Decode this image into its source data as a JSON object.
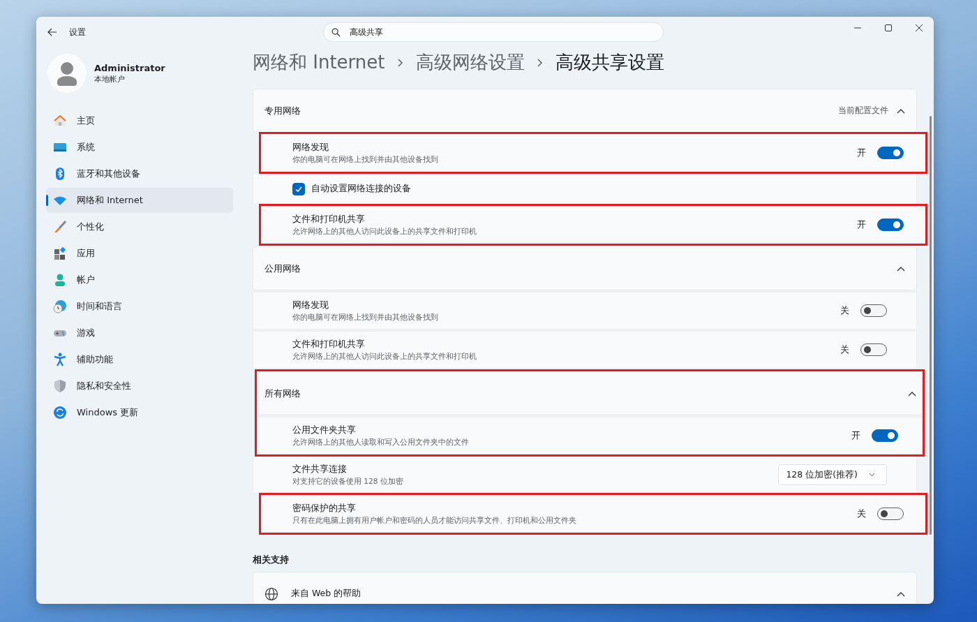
{
  "window": {
    "title": "设置"
  },
  "search": {
    "value": "高级共享"
  },
  "account": {
    "name": "Administrator",
    "type": "本地帐户"
  },
  "nav": [
    {
      "label": "主页",
      "selected": false
    },
    {
      "label": "系统",
      "selected": false
    },
    {
      "label": "蓝牙和其他设备",
      "selected": false
    },
    {
      "label": "网络和 Internet",
      "selected": true
    },
    {
      "label": "个性化",
      "selected": false
    },
    {
      "label": "应用",
      "selected": false
    },
    {
      "label": "帐户",
      "selected": false
    },
    {
      "label": "时间和语言",
      "selected": false
    },
    {
      "label": "游戏",
      "selected": false
    },
    {
      "label": "辅助功能",
      "selected": false
    },
    {
      "label": "隐私和安全性",
      "selected": false
    },
    {
      "label": "Windows 更新",
      "selected": false
    }
  ],
  "breadcrumb": [
    "网络和 Internet",
    "高级网络设置",
    "高级共享设置"
  ],
  "sections": [
    {
      "title": "专用网络",
      "note": "当前配置文件",
      "expanded": true,
      "highlighted": false,
      "items": [
        {
          "kind": "toggle",
          "title": "网络发现",
          "desc": "你的电脑可在网络上找到并由其他设备找到",
          "on": true,
          "state": "开",
          "highlighted": true
        },
        {
          "kind": "checkbox",
          "label": "自动设置网络连接的设备",
          "checked": true,
          "highlighted": false
        },
        {
          "kind": "toggle",
          "title": "文件和打印机共享",
          "desc": "允许网络上的其他人访问此设备上的共享文件和打印机",
          "on": true,
          "state": "开",
          "highlighted": true
        }
      ]
    },
    {
      "title": "公用网络",
      "expanded": true,
      "highlighted": false,
      "items": [
        {
          "kind": "toggle",
          "title": "网络发现",
          "desc": "你的电脑可在网络上找到并由其他设备找到",
          "on": false,
          "state": "关",
          "highlighted": false
        },
        {
          "kind": "toggle",
          "title": "文件和打印机共享",
          "desc": "允许网络上的其他人访问此设备上的共享文件和打印机",
          "on": false,
          "state": "关",
          "highlighted": false
        }
      ]
    },
    {
      "title": "所有网络",
      "expanded": true,
      "highlighted": true,
      "items": [
        {
          "kind": "toggle",
          "title": "公用文件夹共享",
          "desc": "允许网络上的其他人读取和写入公用文件夹中的文件",
          "on": true,
          "state": "开",
          "highlighted": false
        },
        {
          "kind": "dropdown",
          "title": "文件共享连接",
          "desc": "对支持它的设备使用 128 位加密",
          "value": "128 位加密(推荐)",
          "highlighted": false
        },
        {
          "kind": "toggle",
          "title": "密码保护的共享",
          "desc": "只有在此电脑上拥有用户帐户和密码的人员才能访问共享文件、打印机和公用文件夹",
          "on": false,
          "state": "关",
          "highlighted": true
        }
      ]
    }
  ],
  "related": {
    "heading": "相关支持",
    "items": [
      {
        "label": "来自 Web 的帮助",
        "expanded": true
      }
    ]
  }
}
